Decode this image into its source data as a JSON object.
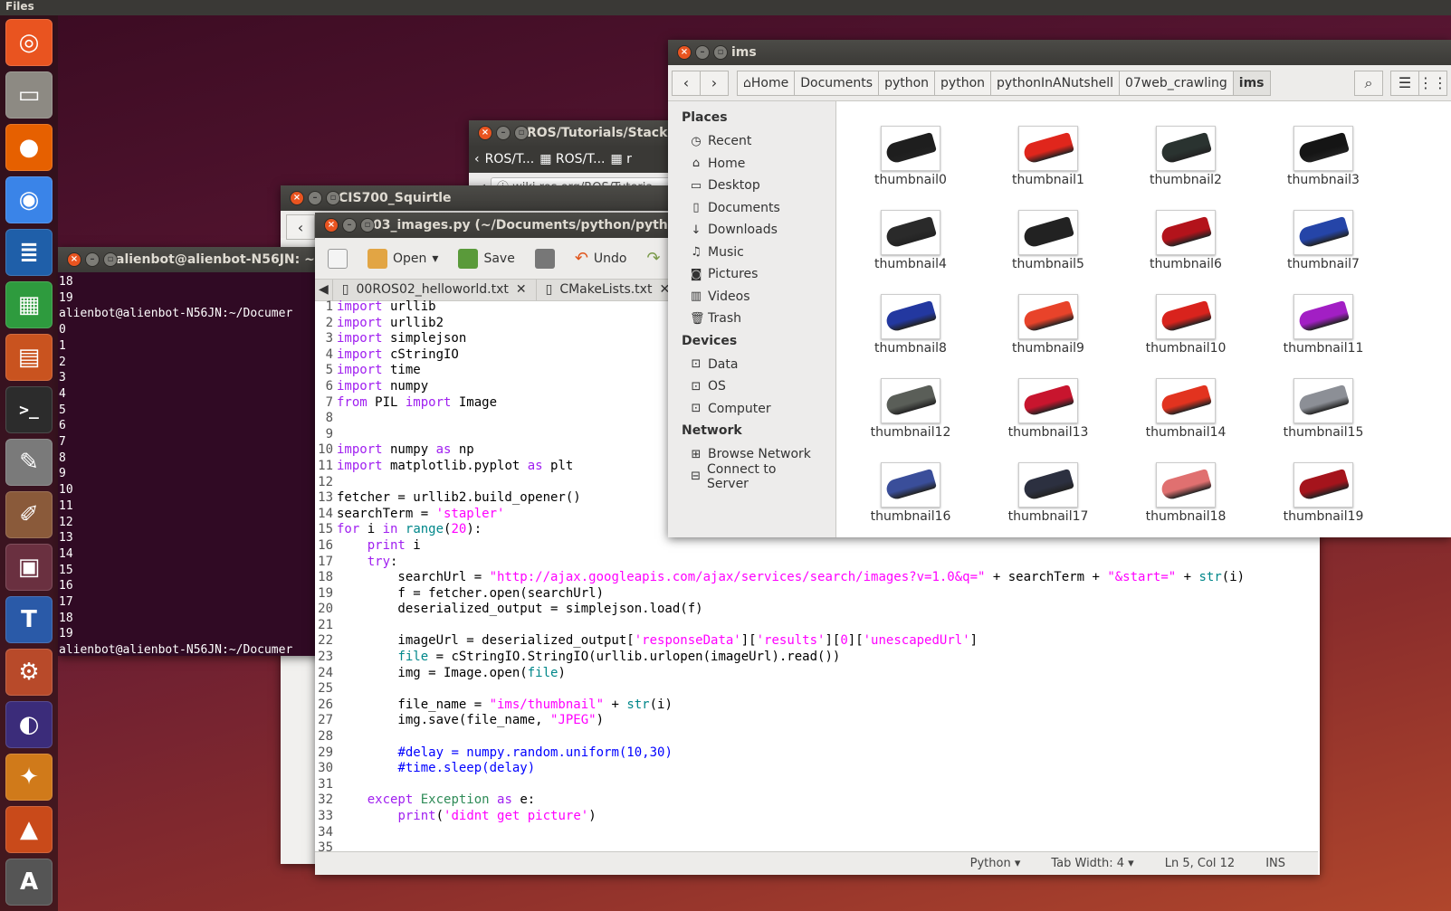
{
  "topbar": {
    "title": "Files"
  },
  "launcher": {
    "icons": [
      {
        "name": "ubuntu-dash-icon",
        "glyph": "◎",
        "color": "#e95420"
      },
      {
        "name": "files-icon",
        "glyph": "▭",
        "color": "#8d8a83"
      },
      {
        "name": "firefox-icon",
        "glyph": "●",
        "color": "#e66000"
      },
      {
        "name": "chrome-icon",
        "glyph": "◉",
        "color": "#3a84e8"
      },
      {
        "name": "writer-icon",
        "glyph": "≣",
        "color": "#1f5fa9"
      },
      {
        "name": "calc-icon",
        "glyph": "▦",
        "color": "#2e9b3e"
      },
      {
        "name": "impress-icon",
        "glyph": "▤",
        "color": "#c9531f"
      },
      {
        "name": "terminal-icon",
        "glyph": ">_",
        "color": "#2c2c2c"
      },
      {
        "name": "text-editor-icon",
        "glyph": "✎",
        "color": "#7a7a7a"
      },
      {
        "name": "paint-icon",
        "glyph": "✐",
        "color": "#8a5a3a"
      },
      {
        "name": "workspace-switcher-icon",
        "glyph": "▣",
        "color": "#6a3040"
      },
      {
        "name": "texmaker-icon",
        "glyph": "T",
        "color": "#2a5aa8"
      },
      {
        "name": "settings-icon",
        "glyph": "⚙",
        "color": "#b84a2a"
      },
      {
        "name": "eclipse-icon",
        "glyph": "◐",
        "color": "#3b2c7a"
      },
      {
        "name": "tool-icon",
        "glyph": "✦",
        "color": "#d07a1a"
      },
      {
        "name": "matlab-icon",
        "glyph": "▲",
        "color": "#c94a1a"
      },
      {
        "name": "updater-icon",
        "glyph": "A",
        "color": "#555555"
      }
    ]
  },
  "terminal": {
    "title": "alienbot@alienbot-N56JN: ~/D",
    "lines": [
      "18",
      "19",
      "alienbot@alienbot-N56JN:~/Documer",
      "0",
      "1",
      "2",
      "3",
      "4",
      "5",
      "6",
      "7",
      "8",
      "9",
      "10",
      "11",
      "12",
      "13",
      "14",
      "15",
      "16",
      "17",
      "18",
      "19",
      "alienbot@alienbot-N56JN:~/Documer"
    ]
  },
  "browser": {
    "title": "ROS/Tutorials/Stackl",
    "tabs": [
      "ROS/T...",
      "ROS/T...",
      "r"
    ],
    "url": "wiki.ros.org/ROS/Tutoria"
  },
  "squirtle": {
    "title": "CIS700_Squirtle"
  },
  "gedit": {
    "title": "03_images.py (~/Documents/python/python/p",
    "toolbar": {
      "open": "Open",
      "save": "Save",
      "undo": "Undo"
    },
    "tabs": [
      "00ROS02_helloworld.txt",
      "CMakeLists.txt"
    ],
    "status": {
      "lang": "Python ▾",
      "tab": "Tab Width: 4 ▾",
      "pos": "Ln 5, Col 12",
      "mode": "INS"
    }
  },
  "files": {
    "title": "ims",
    "crumbs": [
      "Home",
      "Documents",
      "python",
      "python",
      "pythonInANutshell",
      "07web_crawling",
      "ims"
    ],
    "sidebar": {
      "places_header": "Places",
      "places": [
        {
          "icon": "◷",
          "label": "Recent"
        },
        {
          "icon": "⌂",
          "label": "Home"
        },
        {
          "icon": "▭",
          "label": "Desktop"
        },
        {
          "icon": "▯",
          "label": "Documents"
        },
        {
          "icon": "↓",
          "label": "Downloads"
        },
        {
          "icon": "♫",
          "label": "Music"
        },
        {
          "icon": "◙",
          "label": "Pictures"
        },
        {
          "icon": "▥",
          "label": "Videos"
        },
        {
          "icon": "🗑",
          "label": "Trash"
        }
      ],
      "devices_header": "Devices",
      "devices": [
        {
          "icon": "⊡",
          "label": "Data"
        },
        {
          "icon": "⊡",
          "label": "OS"
        },
        {
          "icon": "⊡",
          "label": "Computer"
        }
      ],
      "network_header": "Network",
      "network": [
        {
          "icon": "⊞",
          "label": "Browse Network"
        },
        {
          "icon": "⊟",
          "label": "Connect to Server"
        }
      ]
    },
    "items": [
      {
        "label": "thumbnail0",
        "color": "#1e1e1e"
      },
      {
        "label": "thumbnail1",
        "color": "#e0261c"
      },
      {
        "label": "thumbnail2",
        "color": "#2a3330"
      },
      {
        "label": "thumbnail3",
        "color": "#151515"
      },
      {
        "label": "thumbnail4",
        "color": "#2a2a2a"
      },
      {
        "label": "thumbnail5",
        "color": "#222222"
      },
      {
        "label": "thumbnail6",
        "color": "#b3131b"
      },
      {
        "label": "thumbnail7",
        "color": "#2545a8"
      },
      {
        "label": "thumbnail8",
        "color": "#2338a0"
      },
      {
        "label": "thumbnail9",
        "color": "#e8432a"
      },
      {
        "label": "thumbnail10",
        "color": "#d9231d"
      },
      {
        "label": "thumbnail11",
        "color": "#a21fc4"
      },
      {
        "label": "thumbnail12",
        "color": "#5a5e58"
      },
      {
        "label": "thumbnail13",
        "color": "#c8152e"
      },
      {
        "label": "thumbnail14",
        "color": "#e2331f"
      },
      {
        "label": "thumbnail15",
        "color": "#8c8f96"
      },
      {
        "label": "thumbnail16",
        "color": "#3a4e9a"
      },
      {
        "label": "thumbnail17",
        "color": "#2c3040"
      },
      {
        "label": "thumbnail18",
        "color": "#e07070"
      },
      {
        "label": "thumbnail19",
        "color": "#a5141c"
      }
    ]
  },
  "code": [
    {
      "n": "1",
      "t": [
        [
          "kw",
          "import"
        ],
        [
          "",
          "",
          " urllib"
        ]
      ]
    },
    {
      "n": "2",
      "t": [
        [
          "kw",
          "import"
        ],
        [
          "",
          " urllib2"
        ]
      ]
    },
    {
      "n": "3",
      "t": [
        [
          "kw",
          "import"
        ],
        [
          "",
          " simplejson"
        ]
      ]
    },
    {
      "n": "4",
      "t": [
        [
          "kw",
          "import"
        ],
        [
          "",
          " cStringIO"
        ]
      ]
    },
    {
      "n": "5",
      "t": [
        [
          "kw",
          "import"
        ],
        [
          "",
          " time"
        ]
      ]
    },
    {
      "n": "6",
      "t": [
        [
          "kw",
          "import"
        ],
        [
          "",
          " numpy"
        ]
      ]
    },
    {
      "n": "7",
      "t": [
        [
          "kw",
          "from"
        ],
        [
          "",
          " PIL "
        ],
        [
          "kw",
          "import"
        ],
        [
          "",
          " Image"
        ]
      ]
    },
    {
      "n": "8",
      "t": []
    },
    {
      "n": "9",
      "t": []
    },
    {
      "n": "10",
      "t": [
        [
          "kw",
          "import"
        ],
        [
          "",
          " numpy "
        ],
        [
          "kw",
          "as"
        ],
        [
          "",
          " np"
        ]
      ]
    },
    {
      "n": "11",
      "t": [
        [
          "kw",
          "import"
        ],
        [
          "",
          " matplotlib.pyplot "
        ],
        [
          "kw",
          "as"
        ],
        [
          "",
          " plt"
        ]
      ]
    },
    {
      "n": "12",
      "t": []
    },
    {
      "n": "13",
      "t": [
        [
          "",
          "fetcher = urllib2.build_opener()"
        ]
      ]
    },
    {
      "n": "14",
      "t": [
        [
          "",
          "searchTerm = "
        ],
        [
          "st",
          "'stapler'"
        ]
      ]
    },
    {
      "n": "15",
      "t": [
        [
          "kw",
          "for"
        ],
        [
          "",
          " i "
        ],
        [
          "kw",
          "in"
        ],
        [
          "",
          " "
        ],
        [
          "bi",
          "range"
        ],
        [
          "",
          "("
        ],
        [
          "st",
          "20"
        ],
        [
          "",
          "):"
        ]
      ]
    },
    {
      "n": "16",
      "t": [
        [
          "",
          "    "
        ],
        [
          "kw",
          "print"
        ],
        [
          "",
          " i"
        ]
      ]
    },
    {
      "n": "17",
      "t": [
        [
          "",
          "    "
        ],
        [
          "kw",
          "try"
        ],
        [
          "",
          ":"
        ]
      ]
    },
    {
      "n": "18",
      "t": [
        [
          "",
          "        searchUrl = "
        ],
        [
          "st",
          "\"http://ajax.googleapis.com/ajax/services/search/images?v=1.0&q=\""
        ],
        [
          "",
          " + searchTerm + "
        ],
        [
          "st",
          "\"&start=\""
        ],
        [
          "",
          " + "
        ],
        [
          "bi",
          "str"
        ],
        [
          "",
          "(i)"
        ]
      ]
    },
    {
      "n": "19",
      "t": [
        [
          "",
          "        f = fetcher.open(searchUrl)"
        ]
      ]
    },
    {
      "n": "20",
      "t": [
        [
          "",
          "        deserialized_output = simplejson.load(f)"
        ]
      ]
    },
    {
      "n": "21",
      "t": []
    },
    {
      "n": "22",
      "t": [
        [
          "",
          "        imageUrl = deserialized_output["
        ],
        [
          "st",
          "'responseData'"
        ],
        [
          "",
          "]["
        ],
        [
          "st",
          "'results'"
        ],
        [
          "",
          "]["
        ],
        [
          "st",
          "0"
        ],
        [
          "",
          "]["
        ],
        [
          "st",
          "'unescapedUrl'"
        ],
        [
          "",
          "]"
        ]
      ]
    },
    {
      "n": "23",
      "t": [
        [
          "",
          "        "
        ],
        [
          "bi",
          "file"
        ],
        [
          "",
          " = cStringIO.StringIO(urllib.urlopen(imageUrl).read())"
        ]
      ]
    },
    {
      "n": "24",
      "t": [
        [
          "",
          "        img = Image.open("
        ],
        [
          "bi",
          "file"
        ],
        [
          "",
          ")"
        ]
      ]
    },
    {
      "n": "25",
      "t": []
    },
    {
      "n": "26",
      "t": [
        [
          "",
          "        file_name = "
        ],
        [
          "st",
          "\"ims/thumbnail\""
        ],
        [
          "",
          " + "
        ],
        [
          "bi",
          "str"
        ],
        [
          "",
          "(i)"
        ]
      ]
    },
    {
      "n": "27",
      "t": [
        [
          "",
          "        img.save(file_name, "
        ],
        [
          "st",
          "\"JPEG\""
        ],
        [
          "",
          ")"
        ]
      ]
    },
    {
      "n": "28",
      "t": []
    },
    {
      "n": "29",
      "t": [
        [
          "",
          "        "
        ],
        [
          "cm",
          "#delay = numpy.random.uniform(10,30)"
        ]
      ]
    },
    {
      "n": "30",
      "t": [
        [
          "",
          "        "
        ],
        [
          "cm",
          "#time.sleep(delay)"
        ]
      ]
    },
    {
      "n": "31",
      "t": []
    },
    {
      "n": "32",
      "t": [
        [
          "",
          "    "
        ],
        [
          "kw",
          "except"
        ],
        [
          "",
          " "
        ],
        [
          "ex",
          "Exception"
        ],
        [
          "",
          " "
        ],
        [
          "kw",
          "as"
        ],
        [
          "",
          " e:"
        ]
      ]
    },
    {
      "n": "33",
      "t": [
        [
          "",
          "        "
        ],
        [
          "kw",
          "print"
        ],
        [
          "",
          "("
        ],
        [
          "st",
          "'didnt get picture'"
        ],
        [
          "",
          ")"
        ]
      ]
    },
    {
      "n": "34",
      "t": []
    },
    {
      "n": "35",
      "t": []
    }
  ]
}
